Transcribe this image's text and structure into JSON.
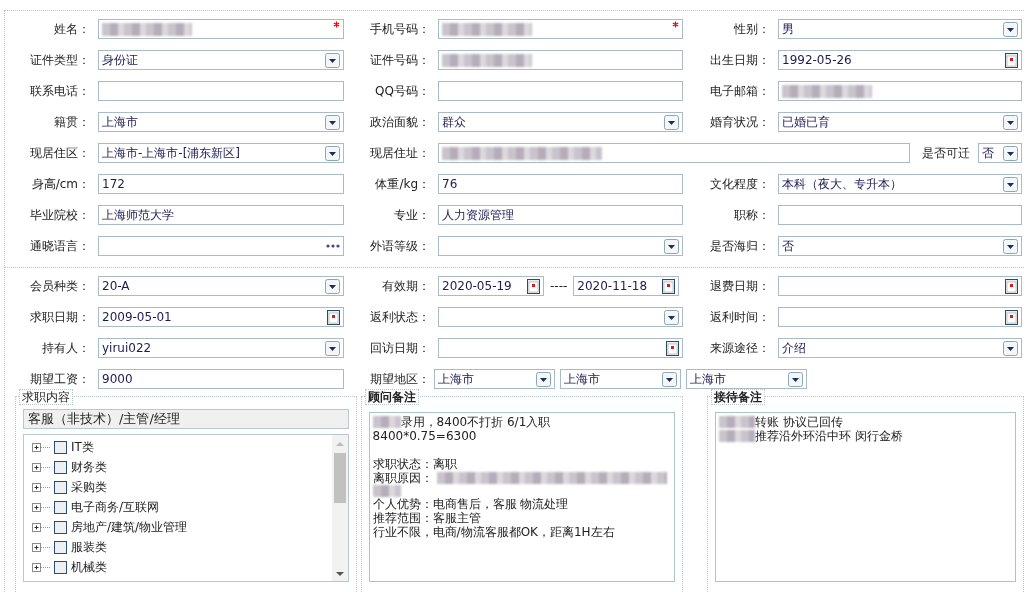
{
  "sections": [
    {
      "rows": [
        [
          {
            "label": "姓名：",
            "kind": "text",
            "masked": true,
            "required": true
          },
          {
            "label": "手机号码：",
            "kind": "text",
            "masked": true,
            "required": true
          },
          {
            "label": "性别：",
            "kind": "select",
            "value": "男"
          }
        ],
        [
          {
            "label": "证件类型：",
            "kind": "select",
            "value": "身份证"
          },
          {
            "label": "证件号码：",
            "kind": "text",
            "masked": true
          },
          {
            "label": "出生日期：",
            "kind": "date",
            "value": "1992-05-26"
          }
        ],
        [
          {
            "label": "联系电话：",
            "kind": "text"
          },
          {
            "label": "QQ号码：",
            "kind": "text"
          },
          {
            "label": "电子邮箱：",
            "kind": "text",
            "masked": true
          }
        ],
        [
          {
            "label": "籍贯：",
            "kind": "select",
            "value": "上海市"
          },
          {
            "label": "政治面貌：",
            "kind": "select",
            "value": "群众"
          },
          {
            "label": "婚育状况：",
            "kind": "select",
            "value": "已婚已育"
          }
        ],
        [
          {
            "label": "现居住区：",
            "kind": "select",
            "value": "上海市-上海市-[浦东新区]"
          },
          {
            "label": "现居住址：",
            "kind": "wide",
            "masked": true,
            "extra": {
              "label": "是否可迁",
              "value": "否"
            }
          }
        ],
        [
          {
            "label": "身高/cm：",
            "kind": "text",
            "value": "172"
          },
          {
            "label": "体重/kg：",
            "kind": "text",
            "value": "76"
          },
          {
            "label": "文化程度：",
            "kind": "select",
            "value": "本科（夜大、专升本）"
          }
        ],
        [
          {
            "label": "毕业院校：",
            "kind": "text",
            "value": "上海师范大学"
          },
          {
            "label": "专业：",
            "kind": "text",
            "value": "人力资源管理"
          },
          {
            "label": "职称：",
            "kind": "text"
          }
        ],
        [
          {
            "label": "通晓语言：",
            "kind": "lookup"
          },
          {
            "label": "外语等级：",
            "kind": "select"
          },
          {
            "label": "是否海归：",
            "kind": "select",
            "value": "否"
          }
        ]
      ]
    },
    {
      "rows": [
        [
          {
            "label": "会员种类：",
            "kind": "select",
            "value": "20-A"
          },
          {
            "label": "有效期：",
            "kind": "range",
            "values": [
              "2020-05-19",
              "2020-11-18"
            ],
            "separator": "----"
          },
          {
            "label": "退费日期：",
            "kind": "date"
          }
        ],
        [
          {
            "label": "求职日期：",
            "kind": "date",
            "value": "2009-05-01"
          },
          {
            "label": "返利状态：",
            "kind": "select"
          },
          {
            "label": "返利时间：",
            "kind": "date"
          }
        ],
        [
          {
            "label": "持有人：",
            "kind": "select",
            "value": "yirui022"
          },
          {
            "label": "回访日期：",
            "kind": "date"
          },
          {
            "label": "来源途径：",
            "kind": "select",
            "value": "介绍"
          }
        ],
        [
          {
            "label": "期望工资：",
            "kind": "text",
            "value": "9000"
          },
          {
            "label": "期望地区：",
            "kind": "multi",
            "values": [
              "上海市",
              "上海市",
              "上海市"
            ]
          }
        ]
      ]
    }
  ],
  "job_panel": {
    "title": "求职内容",
    "selection": "客服（非技术）/主管/经理",
    "tree": [
      {
        "label": "IT类",
        "expanded": false,
        "checked": false
      },
      {
        "label": "财务类",
        "expanded": false,
        "checked": false
      },
      {
        "label": "采购类",
        "expanded": false,
        "checked": false
      },
      {
        "label": "电子商务/互联网",
        "expanded": false,
        "checked": false
      },
      {
        "label": "房地产/建筑/物业管理",
        "expanded": false,
        "checked": false
      },
      {
        "label": "服装类",
        "expanded": false,
        "checked": false
      },
      {
        "label": "机械类",
        "expanded": false,
        "checked": false
      }
    ]
  },
  "notes_panels": [
    {
      "title": "顾问备注",
      "lines": [
        {
          "parts": [
            {
              "kind": "masked"
            },
            {
              "kind": "text",
              "text": "录用，8400不打折 6/1入职"
            }
          ]
        },
        {
          "parts": [
            {
              "kind": "text",
              "text": "8400*0.75=6300"
            }
          ]
        },
        {
          "kind": "blank"
        },
        {
          "parts": [
            {
              "kind": "text",
              "text": "求职状态：离职"
            }
          ]
        },
        {
          "parts": [
            {
              "kind": "text",
              "text": "离职原因："
            },
            {
              "kind": "masked"
            }
          ]
        },
        {
          "parts": [
            {
              "kind": "masked"
            }
          ]
        },
        {
          "parts": [
            {
              "kind": "text",
              "text": "个人优势：电商售后，客服 物流处理"
            }
          ]
        },
        {
          "parts": [
            {
              "kind": "text",
              "text": "推荐范围：客服主管"
            }
          ]
        },
        {
          "parts": [
            {
              "kind": "text",
              "text": "行业不限，电商/物流客服都OK，距离1H左右"
            }
          ]
        }
      ]
    },
    {
      "title": "接待备注",
      "lines": [
        {
          "parts": [
            {
              "kind": "masked"
            },
            {
              "kind": "text",
              "text": "转账  协议已回传"
            }
          ]
        },
        {
          "parts": [
            {
              "kind": "masked"
            },
            {
              "kind": "text",
              "text": "推荐沿外环沿中环 闵行金桥"
            }
          ]
        }
      ]
    }
  ]
}
